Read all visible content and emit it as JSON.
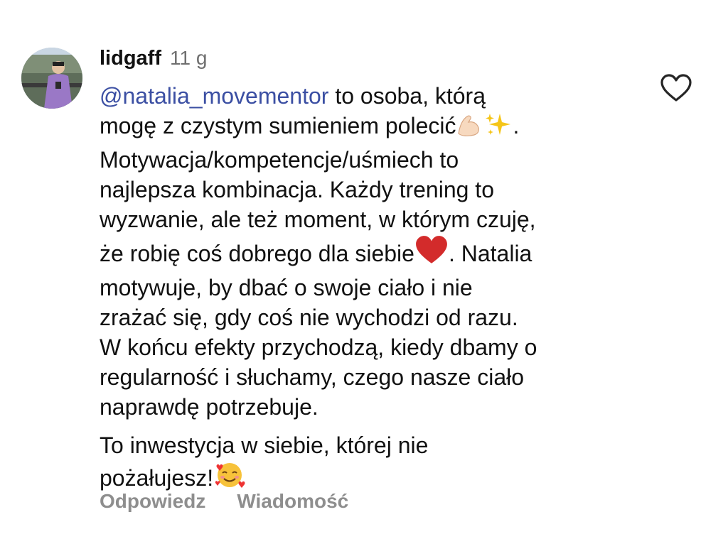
{
  "comment": {
    "username": "lidgaff",
    "time": "11 g",
    "mention": "@natalia_movementor",
    "paragraphs": [
      {
        "lines": [
          {
            "pre": "mogę z czystym sumieniem polecić",
            "emojis": [
              "flexed-biceps-emoji",
              "sparkles-emoji"
            ],
            "post": "."
          },
          {
            "text": "Motywacja/kompetencje/uśmiech to"
          },
          {
            "text": "najlepsza kombinacja. Każdy trening to"
          },
          {
            "text": "wyzwanie, ale też moment, w którym czuję,"
          },
          {
            "pre": "że robię coś dobrego dla siebie",
            "emojis": [
              "red-heart-emoji"
            ],
            "post": ". Natalia"
          },
          {
            "text": "motywuje, by dbać o swoje ciało i nie"
          },
          {
            "text": "zrażać się, gdy coś nie wychodzi od razu."
          },
          {
            "text": "W końcu efekty przychodzą, kiedy dbamy o"
          },
          {
            "text": "regularność i słuchamy, czego nasze ciało"
          },
          {
            "text": "naprawdę potrzebuje."
          }
        ],
        "first_line_rest": " to osoba, którą"
      },
      {
        "lines": [
          {
            "text": "To inwestycja w siebie, której nie"
          },
          {
            "pre": "pożałujesz!",
            "emojis": [
              "smiling-face-with-hearts-emoji"
            ],
            "post": ""
          }
        ]
      }
    ]
  },
  "actions": {
    "reply": "Odpowiedz",
    "message": "Wiadomość"
  },
  "icons": {
    "like": "heart-outline-icon"
  },
  "colors": {
    "mention": "#3b4fa3",
    "secondary_text": "#8e8e8e",
    "heart_emoji": "#d32b2b"
  }
}
